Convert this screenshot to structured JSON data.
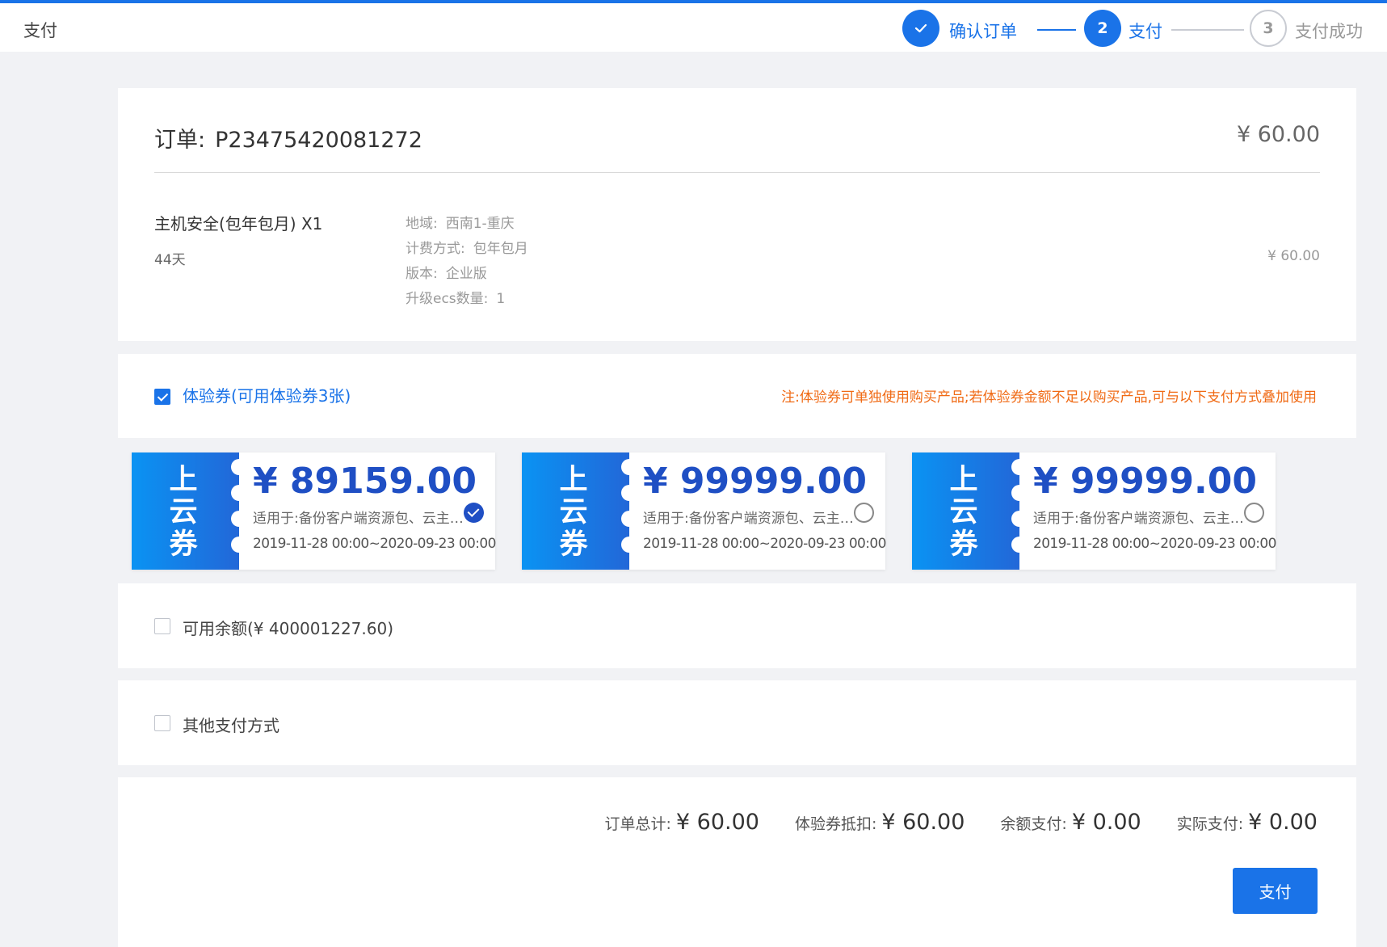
{
  "header": {
    "title": "支付"
  },
  "steps": [
    {
      "num": "✓",
      "label": "确认订单",
      "state": "done"
    },
    {
      "num": "2",
      "label": "支付",
      "state": "active"
    },
    {
      "num": "3",
      "label": "支付成功",
      "state": "todo"
    }
  ],
  "order": {
    "label": "订单:",
    "number": "P23475420081272",
    "total": "¥ 60.00",
    "product": {
      "name": "主机安全(包年包月) X1",
      "duration": "44天",
      "price": "¥ 60.00",
      "specs": [
        {
          "key": "地域:",
          "value": "西南1-重庆"
        },
        {
          "key": "计费方式:",
          "value": "包年包月"
        },
        {
          "key": "版本:",
          "value": "企业版"
        },
        {
          "key": "升级ecs数量:",
          "value": "1"
        }
      ]
    }
  },
  "voucher": {
    "checked": true,
    "label": "体验券(可用体验券3张)",
    "note": "注:体验券可单独使用购买产品;若体验券金额不足以购买产品,可与以下支付方式叠加使用"
  },
  "coupons": [
    {
      "stub": "上云券",
      "amount": "¥ 89159.00",
      "scope": "适用于:备份客户端资源包、云主机、云硬盘",
      "date": "2019-11-28 00:00~2020-09-23 00:00",
      "selected": true
    },
    {
      "stub": "上云券",
      "amount": "¥ 99999.00",
      "scope": "适用于:备份客户端资源包、云主机、云硬盘",
      "date": "2019-11-28 00:00~2020-09-23 00:00",
      "selected": false
    },
    {
      "stub": "上云券",
      "amount": "¥ 99999.00",
      "scope": "适用于:备份客户端资源包、云主机、云硬盘",
      "date": "2019-11-28 00:00~2020-09-23 00:00",
      "selected": false
    }
  ],
  "balance": {
    "checked": false,
    "label": "可用余额(¥ 400001227.60)"
  },
  "other_payment": {
    "checked": false,
    "label": "其他支付方式"
  },
  "summary": {
    "order_total_label": "订单总计:",
    "order_total": "¥ 60.00",
    "voucher_deduct_label": "体验券抵扣:",
    "voucher_deduct": "¥ 60.00",
    "balance_pay_label": "余额支付:",
    "balance_pay": "¥ 0.00",
    "actual_pay_label": "实际支付:",
    "actual_pay": "¥ 0.00"
  },
  "pay_button": "支付",
  "colors": {
    "primary": "#1a73e8",
    "coupon_amount": "#1f4fc4",
    "note": "#f06a14"
  }
}
